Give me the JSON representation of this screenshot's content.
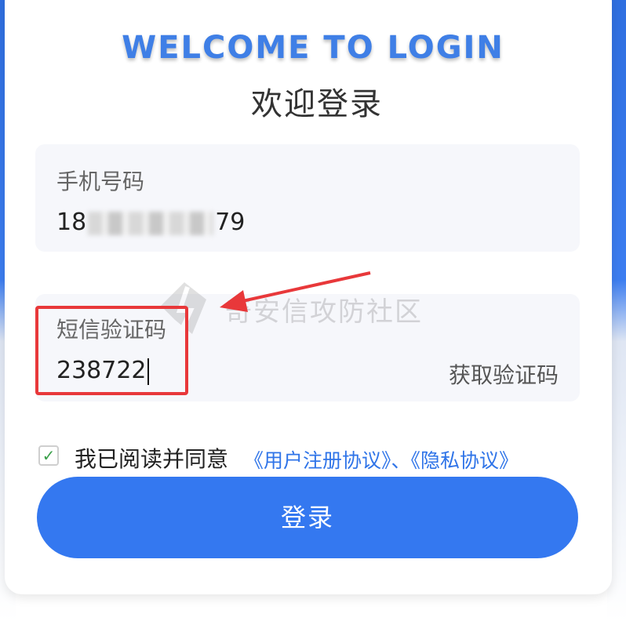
{
  "header": {
    "welcome": "WELCOME TO LOGIN",
    "title": "欢迎登录"
  },
  "phone": {
    "label": "手机号码",
    "value_prefix": "18",
    "value_suffix": "79"
  },
  "sms": {
    "label": "短信验证码",
    "value": "238722",
    "get_code": "获取验证码"
  },
  "watermark": {
    "text": "奇安信攻防社区"
  },
  "agreement": {
    "text": "我已阅读并同意",
    "links": "《用户注册协议》、《隐私协议》",
    "checked": true
  },
  "login_button": "登录",
  "colors": {
    "accent": "#3478f0",
    "highlight": "#e8383a",
    "check": "#3aa04a"
  }
}
